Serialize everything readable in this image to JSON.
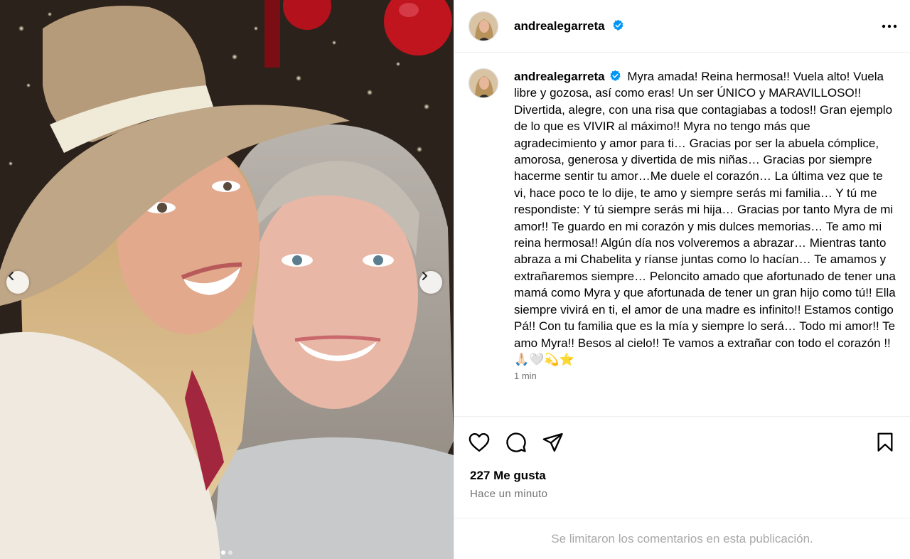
{
  "post": {
    "username": "andrealegarreta",
    "verified": true,
    "caption": "Myra amada! Reina hermosa!! Vuela alto! Vuela libre y gozosa, así como eras! Un ser ÚNICO y MARAVILLOSO!! Divertida, alegre, con una risa que contagiabas a todos!! Gran ejemplo de lo que es VIVIR al máximo!! Myra no tengo más que agradecimiento y amor para ti… Gracias por ser la abuela cómplice, amorosa, generosa y divertida de mis niñas… Gracias por siempre hacerme sentir tu amor…Me duele el corazón… La última vez que te vi, hace poco te lo dije, te amo y siempre serás mi familia… Y tú me respondiste: Y tú siempre serás mi hija… Gracias por tanto Myra de mi amor!! Te guardo en mi corazón y mis dulces memorias… Te amo mi reina hermosa!! Algún día nos volveremos a abrazar… Mientras tanto abraza a mi Chabelita y ríanse juntas como lo hacían… Te amamos y extrañaremos siempre… Peloncito amado que afortunado de tener una mamá como Myra y que afortunada de tener un gran hijo como tú!! Ella siempre vivirá en ti, el amor de una madre es infinito!! Estamos contigo Pá!! Con tu familia que es la mía y siempre lo será… Todo mi amor!! Te amo Myra!! Besos al cielo!! Te vamos a extrañar con todo el corazón !! 🙏🏻🤍💫⭐",
    "caption_time": "1 min",
    "likes_label": "227 Me gusta",
    "posted_label": "Hace un minuto",
    "comments_limited_label": "Se limitaron los comentarios en esta publicación."
  },
  "icons": {
    "more": "more-options-icon",
    "like": "heart-icon",
    "comment": "comment-icon",
    "share": "share-icon",
    "save": "bookmark-icon",
    "prev": "chevron-left-icon",
    "next": "chevron-right-icon",
    "verified": "verified-badge-icon"
  },
  "colors": {
    "verified_blue": "#0095f6",
    "muted_text": "#737373",
    "limited_text": "#a8a8a8",
    "border": "#efefef"
  },
  "carousel": {
    "current_slide": 1,
    "total_slides": 2
  }
}
